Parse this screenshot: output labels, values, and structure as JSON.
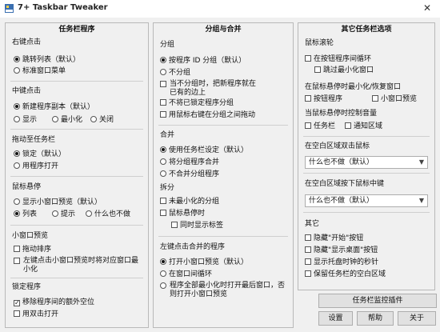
{
  "window": {
    "title": "7+ Taskbar Tweaker",
    "close_glyph": "✕"
  },
  "col1": {
    "title": "任务栏程序",
    "right_click": {
      "label": "右键点击",
      "options": [
        "跳转列表（默认）",
        "标准窗口菜单"
      ]
    },
    "middle_click": {
      "label": "中键点击",
      "option_default": "新建程序副本（默认）",
      "options": [
        "显示",
        "最小化",
        "关闭"
      ]
    },
    "drag": {
      "label": "拖动至任务栏",
      "options": [
        "锁定（默认）",
        "用程序打开"
      ]
    },
    "hover": {
      "label": "鼠标悬停",
      "option_default": "显示小窗口预览（默认）",
      "options": [
        "列表",
        "提示",
        "什么也不做"
      ]
    },
    "thumbnail": {
      "label": "小窗口预览",
      "checks": [
        "拖动排序",
        "左键点击小窗口预览时将对应窗口最小化"
      ]
    },
    "pinned": {
      "label": "锁定程序",
      "checks": [
        "移除程序间的额外空位",
        "用双击打开"
      ]
    }
  },
  "col2": {
    "title": "分组与合并",
    "group": {
      "label": "分组",
      "options": [
        "按程序 ID 分组（默认）",
        "不分组"
      ],
      "checks": [
        "当不分组时，把新程序就在已有的边上",
        "不将已锁定程序分组",
        "用鼠标右键在分组之间拖动"
      ]
    },
    "combine": {
      "label": "合并",
      "options": [
        "使用任务栏设定（默认）",
        "将分组程序合并",
        "不合并分组程序"
      ]
    },
    "split": {
      "label": "拆分",
      "checks": [
        "未最小化的分组",
        "鼠标悬停时",
        "同时显示标签"
      ]
    },
    "left_click": {
      "label": "左键点击合并的程序",
      "options": [
        "打开小窗口预览（默认）",
        "在窗口间循环",
        "程序全部最小化时打开最后窗口，否则打开小窗口预览"
      ]
    }
  },
  "col3": {
    "title": "其它任务栏选项",
    "scroll": {
      "label": "鼠标滚轮",
      "checks": [
        "在按钮程序间循环",
        "跳过最小化窗口"
      ]
    },
    "hover_min": {
      "label": "在鼠标悬停时最小化/恢复窗口",
      "checks": [
        "按钮程序",
        "小窗口预览"
      ]
    },
    "hover_vol": {
      "label": "当鼠标悬停时控制音量",
      "checks": [
        "任务栏",
        "通知区域"
      ]
    },
    "dblclick": {
      "label": "在空白区域双击鼠标",
      "value": "什么也不做（默认）"
    },
    "midclick": {
      "label": "在空白区域按下鼠标中键",
      "value": "什么也不做（默认）"
    },
    "other": {
      "label": "其它",
      "checks": [
        "隐藏\"开始\"按钮",
        "隐藏\"显示桌面\"按钮",
        "显示托盘时钟的秒针",
        "保留任务栏的空白区域"
      ]
    }
  },
  "buttons": {
    "inspector": "任务栏监控插件",
    "settings": "设置",
    "help": "帮助",
    "about": "关于"
  },
  "icons": {
    "app": "taskbar-app-icon",
    "close": "close-icon",
    "dropdown": "chevron-down-icon"
  },
  "colors": {
    "window_bg": "#f0f0f0",
    "border": "#b9b9b9"
  }
}
